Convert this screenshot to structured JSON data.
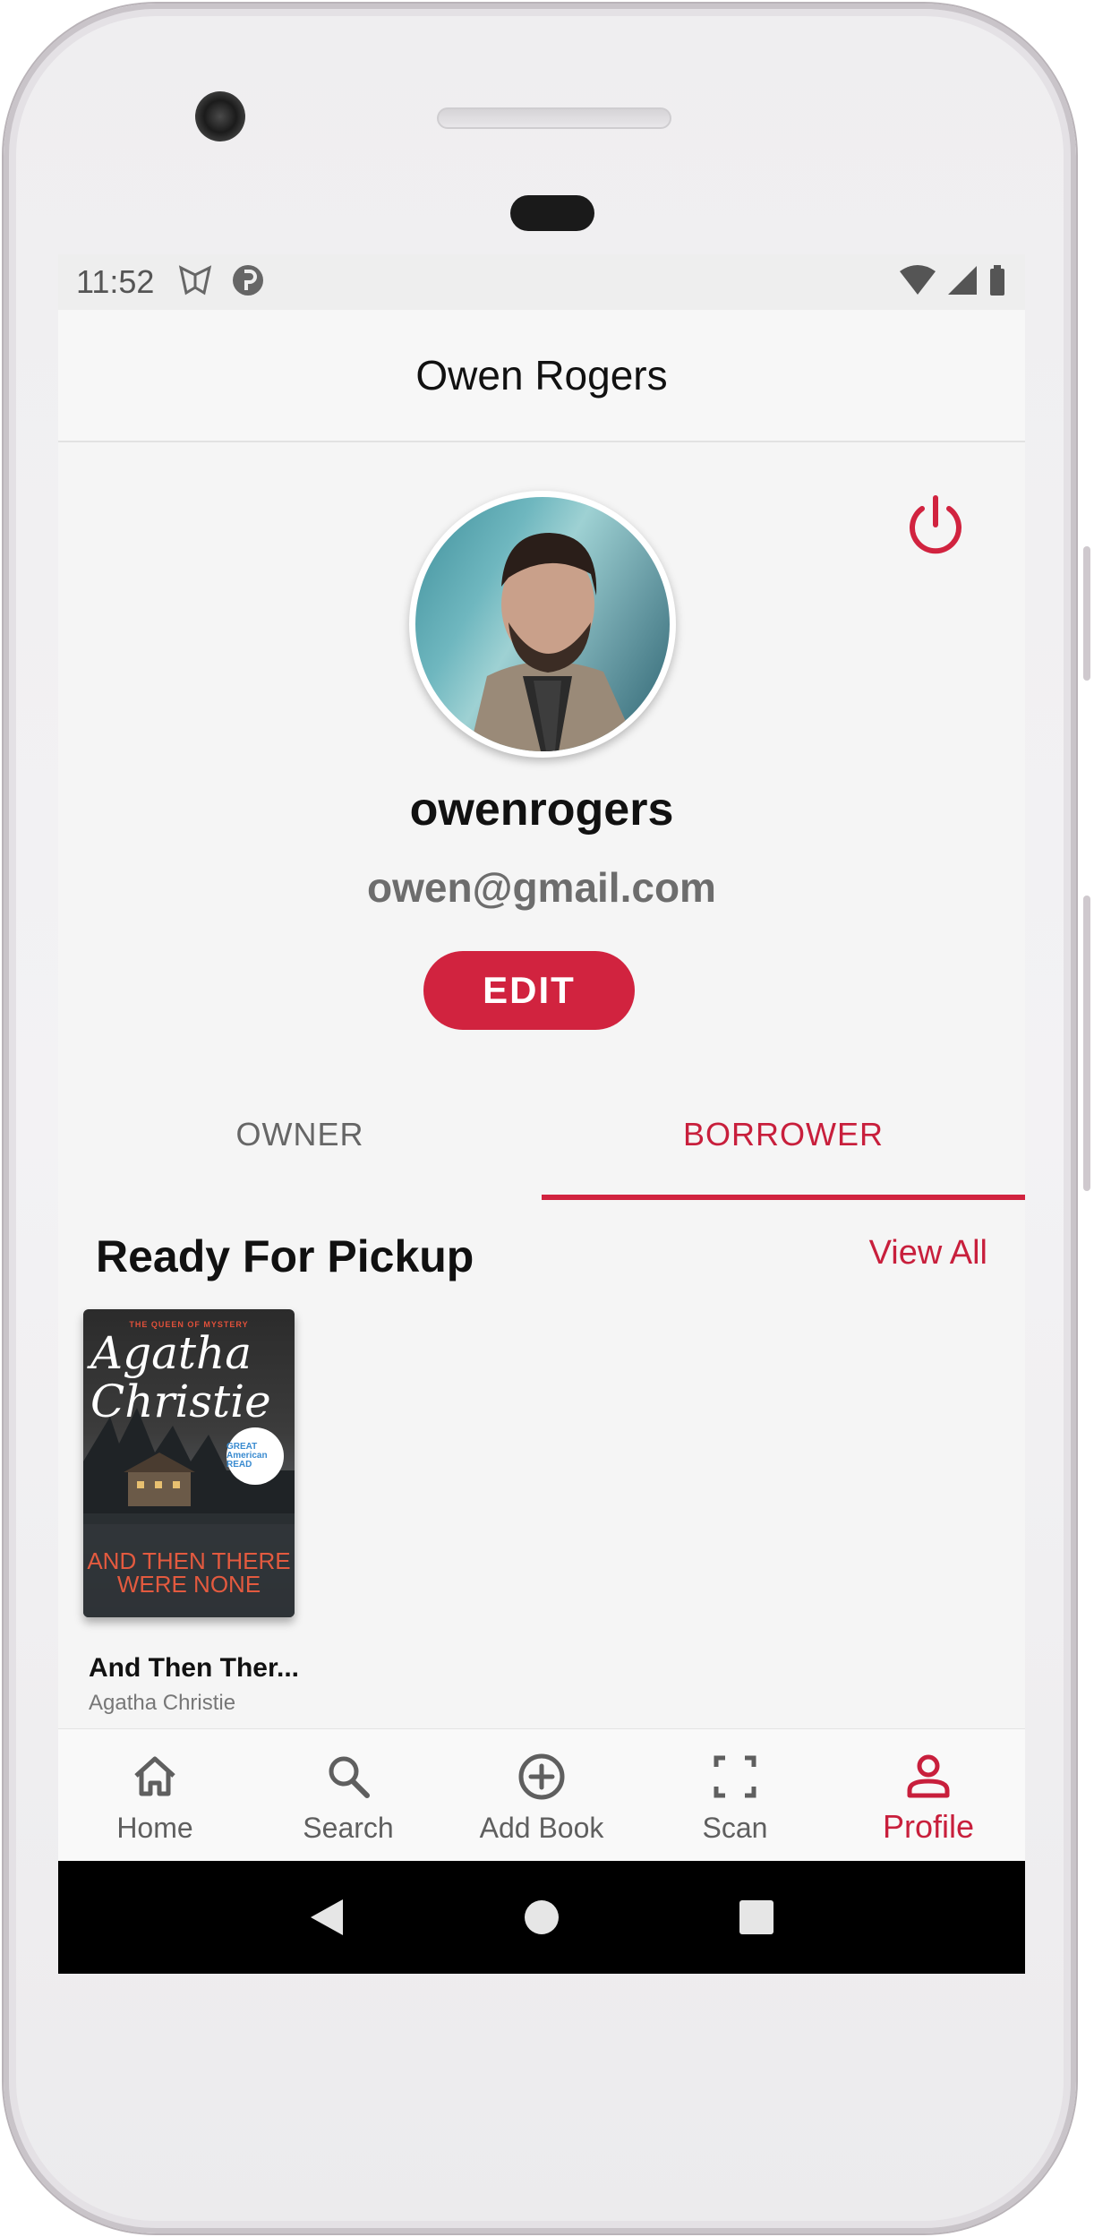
{
  "status_bar": {
    "time": "11:52"
  },
  "app_bar": {
    "title": "Owen Rogers"
  },
  "profile": {
    "username": "owenrogers",
    "email": "owen@gmail.com",
    "edit_label": "EDIT"
  },
  "tabs": [
    {
      "label": "OWNER",
      "selected": false
    },
    {
      "label": "BORROWER",
      "selected": true
    }
  ],
  "section": {
    "title": "Ready For Pickup",
    "view_all_label": "View All"
  },
  "books": [
    {
      "title": "And Then Ther...",
      "author": "Agatha Christie",
      "cover": {
        "tagline": "THE QUEEN OF MYSTERY",
        "author": "Agatha Christie",
        "title": "AND THEN THERE WERE NONE",
        "badge": "GREAT American READ"
      }
    }
  ],
  "bottom_nav": [
    {
      "label": "Home",
      "icon": "home-icon"
    },
    {
      "label": "Search",
      "icon": "search-icon"
    },
    {
      "label": "Add Book",
      "icon": "add-circle-icon"
    },
    {
      "label": "Scan",
      "icon": "scan-icon"
    },
    {
      "label": "Profile",
      "icon": "person-icon",
      "active": true
    }
  ],
  "colors": {
    "accent": "#d1233f",
    "background": "#f5f5f5",
    "system_nav": "#000000"
  }
}
